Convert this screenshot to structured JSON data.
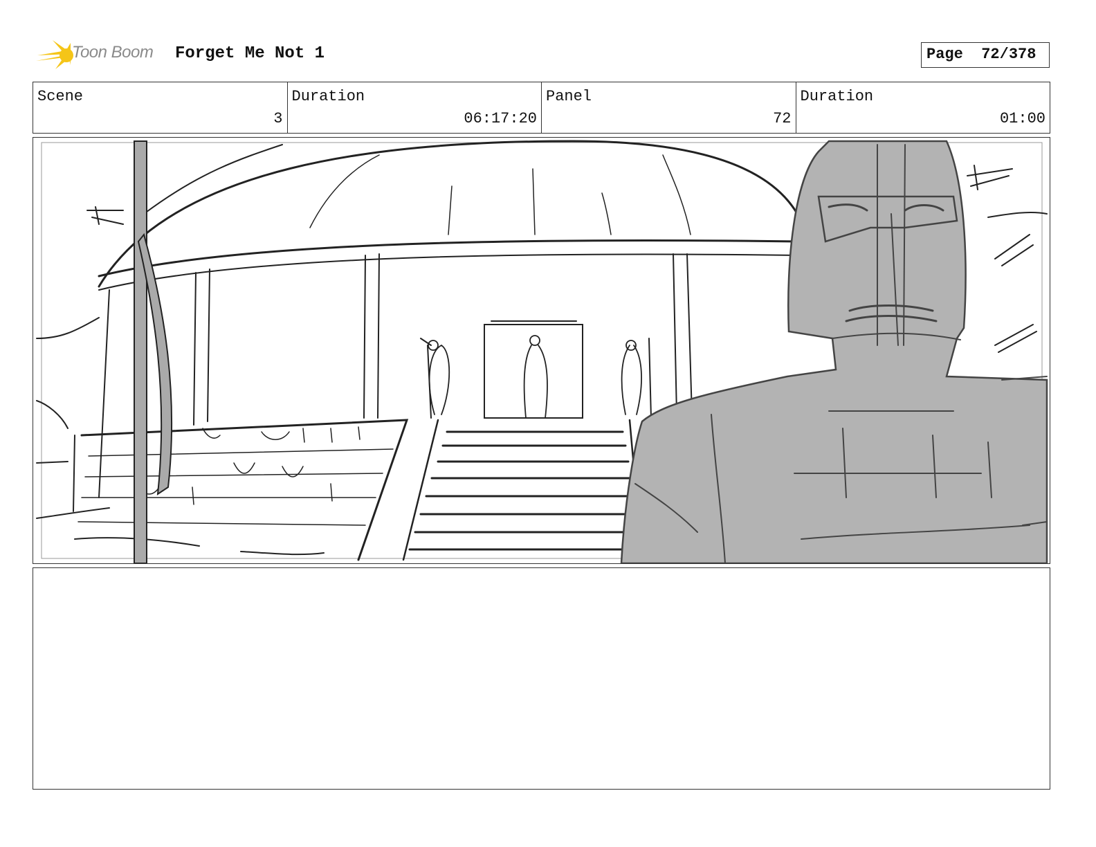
{
  "header": {
    "logo_text": "Toon Boom",
    "title": "Forget Me Not 1",
    "page_label": "Page",
    "page_value": "72/378"
  },
  "info": [
    {
      "label": "Scene",
      "value": "3"
    },
    {
      "label": "Duration",
      "value": "06:17:20"
    },
    {
      "label": "Panel",
      "value": "72"
    },
    {
      "label": "Duration",
      "value": "01:00"
    }
  ],
  "colors": {
    "logo_accent": "#f5c518",
    "sketch_fill": "#b3b3b3"
  },
  "notes": ""
}
